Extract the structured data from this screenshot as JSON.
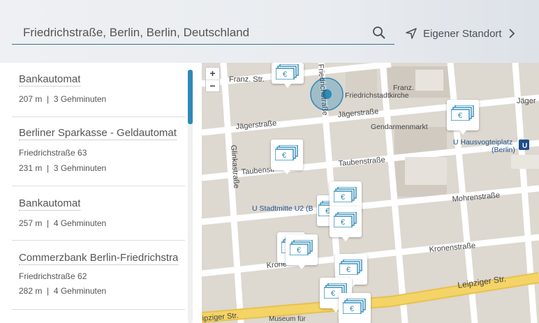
{
  "search": {
    "value": "Friedrichstraße, Berlin, Berlin, Deutschland",
    "icon": "search-icon"
  },
  "locate": {
    "label": "Eigener Standort",
    "icon": "navigation-arrow-icon",
    "chevron": "chevron-right-icon"
  },
  "results": [
    {
      "name": "Bankautomat",
      "address": "",
      "distance": "207 m",
      "time": "3 Gehminuten"
    },
    {
      "name": "Berliner Sparkasse - Geldautomat",
      "address": "Friedrichstraße 63",
      "distance": "231 m",
      "time": "3 Gehminuten"
    },
    {
      "name": "Bankautomat",
      "address": "",
      "distance": "257 m",
      "time": "4 Gehminuten"
    },
    {
      "name": "Commerzbank Berlin-Friedrichstraße",
      "address": "Friedrichstraße 62",
      "distance": "282 m",
      "time": "4 Gehminuten"
    }
  ],
  "map": {
    "zoom_in": "+",
    "zoom_out": "−",
    "labels": {
      "franz_str": "Franz. Str.",
      "friedrichstrasse": "Friedrichstraße",
      "friedrichstadtkirche": "Friedrichstadtkirche",
      "franz": "Franz.",
      "jaegerstrasse_1": "Jägerstraße",
      "jaegerstrasse_2": "Jägerstraße",
      "jaeger_right": "Jäger",
      "gendarmenmarkt": "Gendarmenmarkt",
      "hausvogteiplatz": "U Hausvogteiplatz",
      "hausvogteiplatz_sub": "(Berlin)",
      "glinkastrasse": "Glinkastraße",
      "taubenstrasse_1": "Taubenstr",
      "taubenstrasse_2": "Taubenstraße",
      "stadtmitte": "U Stadtmitte U2 (B",
      "mohrenstrasse": "Mohrenstraße",
      "kronenstrasse_1": "Kronenstraße",
      "kronenstrasse_2": "Krone",
      "leipziger_1": "Leipziger Str.",
      "leipziger_2": "ipziger Str.",
      "museum": "Museum für",
      "ubahn_badge": "U"
    },
    "colors": {
      "road": "#ffffff",
      "block": "#ddd8d0",
      "major_road": "#f2cf5c",
      "location": "#2e8ab8",
      "atm_icon": "#2e8ab8"
    },
    "atm_icon": "euro-banknote-icon"
  }
}
